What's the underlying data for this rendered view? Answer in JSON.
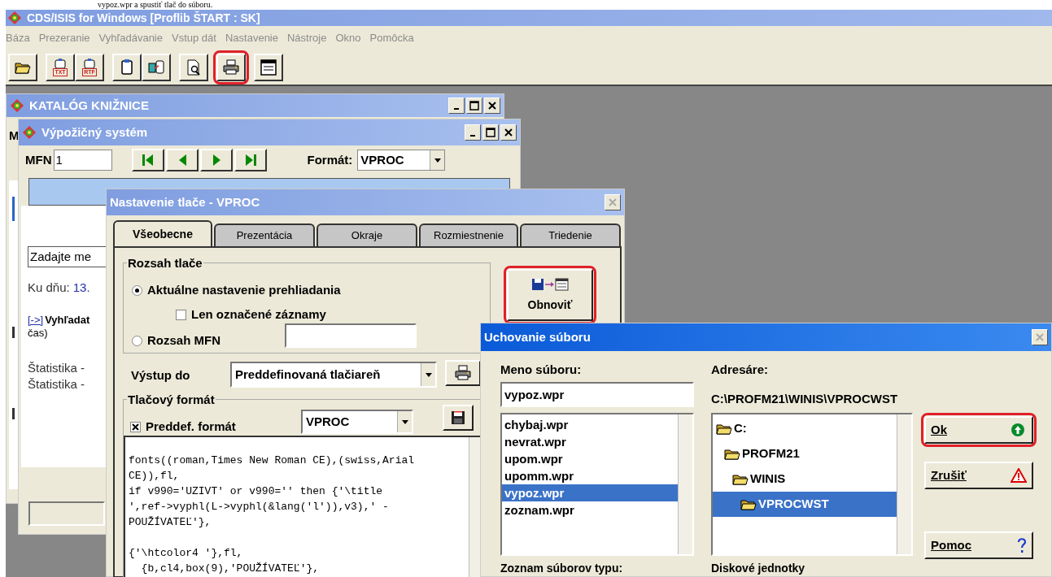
{
  "caption": "vypoz.wpr a spustiť tlač do súboru.",
  "app": {
    "title": "CDS/ISIS for Windows [Proflib ŠTART : SK]",
    "menu": [
      "Báza",
      "Prezeranie",
      "Vyhľadávanie",
      "Vstup dát",
      "Nastavenie",
      "Nástroje",
      "Okno",
      "Pomôcka"
    ],
    "toolbar": [
      [
        {
          "kind": "open",
          "highlighted": false
        }
      ],
      [
        {
          "kind": "export",
          "label": "TXT",
          "highlighted": false
        },
        {
          "kind": "export",
          "label": "RTF",
          "highlighted": false
        }
      ],
      [
        {
          "kind": "clipboard",
          "highlighted": false
        },
        {
          "kind": "copy",
          "highlighted": false
        }
      ],
      [
        {
          "kind": "preview",
          "highlighted": false
        }
      ],
      [
        {
          "kind": "print",
          "highlighted": true
        }
      ],
      [
        {
          "kind": "form",
          "highlighted": false
        }
      ]
    ]
  },
  "catalog_window": {
    "title": "KATALÓG KNIŽNICE",
    "menu_fragment": "M"
  },
  "loan_window": {
    "title": "Výpožičný systém",
    "mfn_label": "MFN",
    "mfn_value": "1",
    "nav": [
      {
        "kind": "first"
      },
      {
        "kind": "prev"
      },
      {
        "kind": "next"
      },
      {
        "kind": "last"
      }
    ],
    "format_label": "Formát:",
    "format_value": "VPROC",
    "input_value": "Zadajte me",
    "date_label": "Ku dňu:",
    "date_value": "13.",
    "link": "[->]",
    "search_text": "Vyhľadat",
    "search_text_2": "čas)",
    "statistics": [
      "Štatistika -",
      "Štatistika -"
    ]
  },
  "print_dialog": {
    "title": "Nastavenie tlače - VPROC",
    "tabs": [
      {
        "label": "Všeobecne",
        "selected": true
      },
      {
        "label": "Prezentácia",
        "selected": false
      },
      {
        "label": "Okraje",
        "selected": false
      },
      {
        "label": "Rozmiestnenie",
        "selected": false
      },
      {
        "label": "Triedenie",
        "selected": false
      }
    ],
    "range_group": "Rozsah tlače",
    "range_options": [
      {
        "label": "Aktuálne nastavenie prehliadania",
        "selected": true
      },
      {
        "label": "Rozsah MFN",
        "selected": false
      }
    ],
    "marked_only": {
      "label": "Len označené záznamy",
      "checked": false
    },
    "refresh_button": {
      "label": "Obnoviť",
      "highlighted": true
    },
    "output_label": "Výstup do",
    "output_value": "Preddefinovaná tlačiareň",
    "format_group": "Tlačový formát",
    "predefined": {
      "label": "Preddef. formát",
      "checked": true
    },
    "format_value": "VPROC",
    "code": "\nfonts((roman,Times New Roman CE),(swiss,Arial\nCE)),fl,\nif v990='UZIVT' or v990='' then {'\\title\n',ref->vyphl(L->vyphl(&lang('l')),v3),' -\nPOUŽÍVATEĽ'},\n\n{'\\htcolor4 '},fl,\n  {b,cl4,box(9),'POUŽÍVATEĽ'},"
  },
  "save_dialog": {
    "title": "Uchovanie súboru",
    "file_label": "Meno súboru:",
    "file_value": "vypoz.wpr",
    "files": [
      {
        "name": "chybaj.wpr",
        "selected": false
      },
      {
        "name": "nevrat.wpr",
        "selected": false
      },
      {
        "name": "upom.wpr",
        "selected": false
      },
      {
        "name": "upomm.wpr",
        "selected": false
      },
      {
        "name": "vypoz.wpr",
        "selected": true
      },
      {
        "name": "zoznam.wpr",
        "selected": false
      }
    ],
    "dir_label": "Adresáre:",
    "path": "C:\\PROFM21\\WINIS\\VPROCWST",
    "tree": [
      {
        "name": "C:",
        "selected": false,
        "children": [
          {
            "name": "PROFM21",
            "selected": false,
            "children": [
              {
                "name": "WINIS",
                "selected": false,
                "children": [
                  {
                    "name": "VPROCWST",
                    "selected": true
                  }
                ]
              }
            ]
          }
        ]
      }
    ],
    "buttons": [
      {
        "kind": "ok",
        "label": "Ok",
        "highlighted": true
      },
      {
        "kind": "cancel",
        "label": "Zrušiť",
        "highlighted": false
      },
      {
        "kind": "help",
        "label": "Pomoc",
        "highlighted": false
      }
    ],
    "types_label": "Zoznam súborov typu:",
    "drives_label": "Diskové jednotky"
  }
}
